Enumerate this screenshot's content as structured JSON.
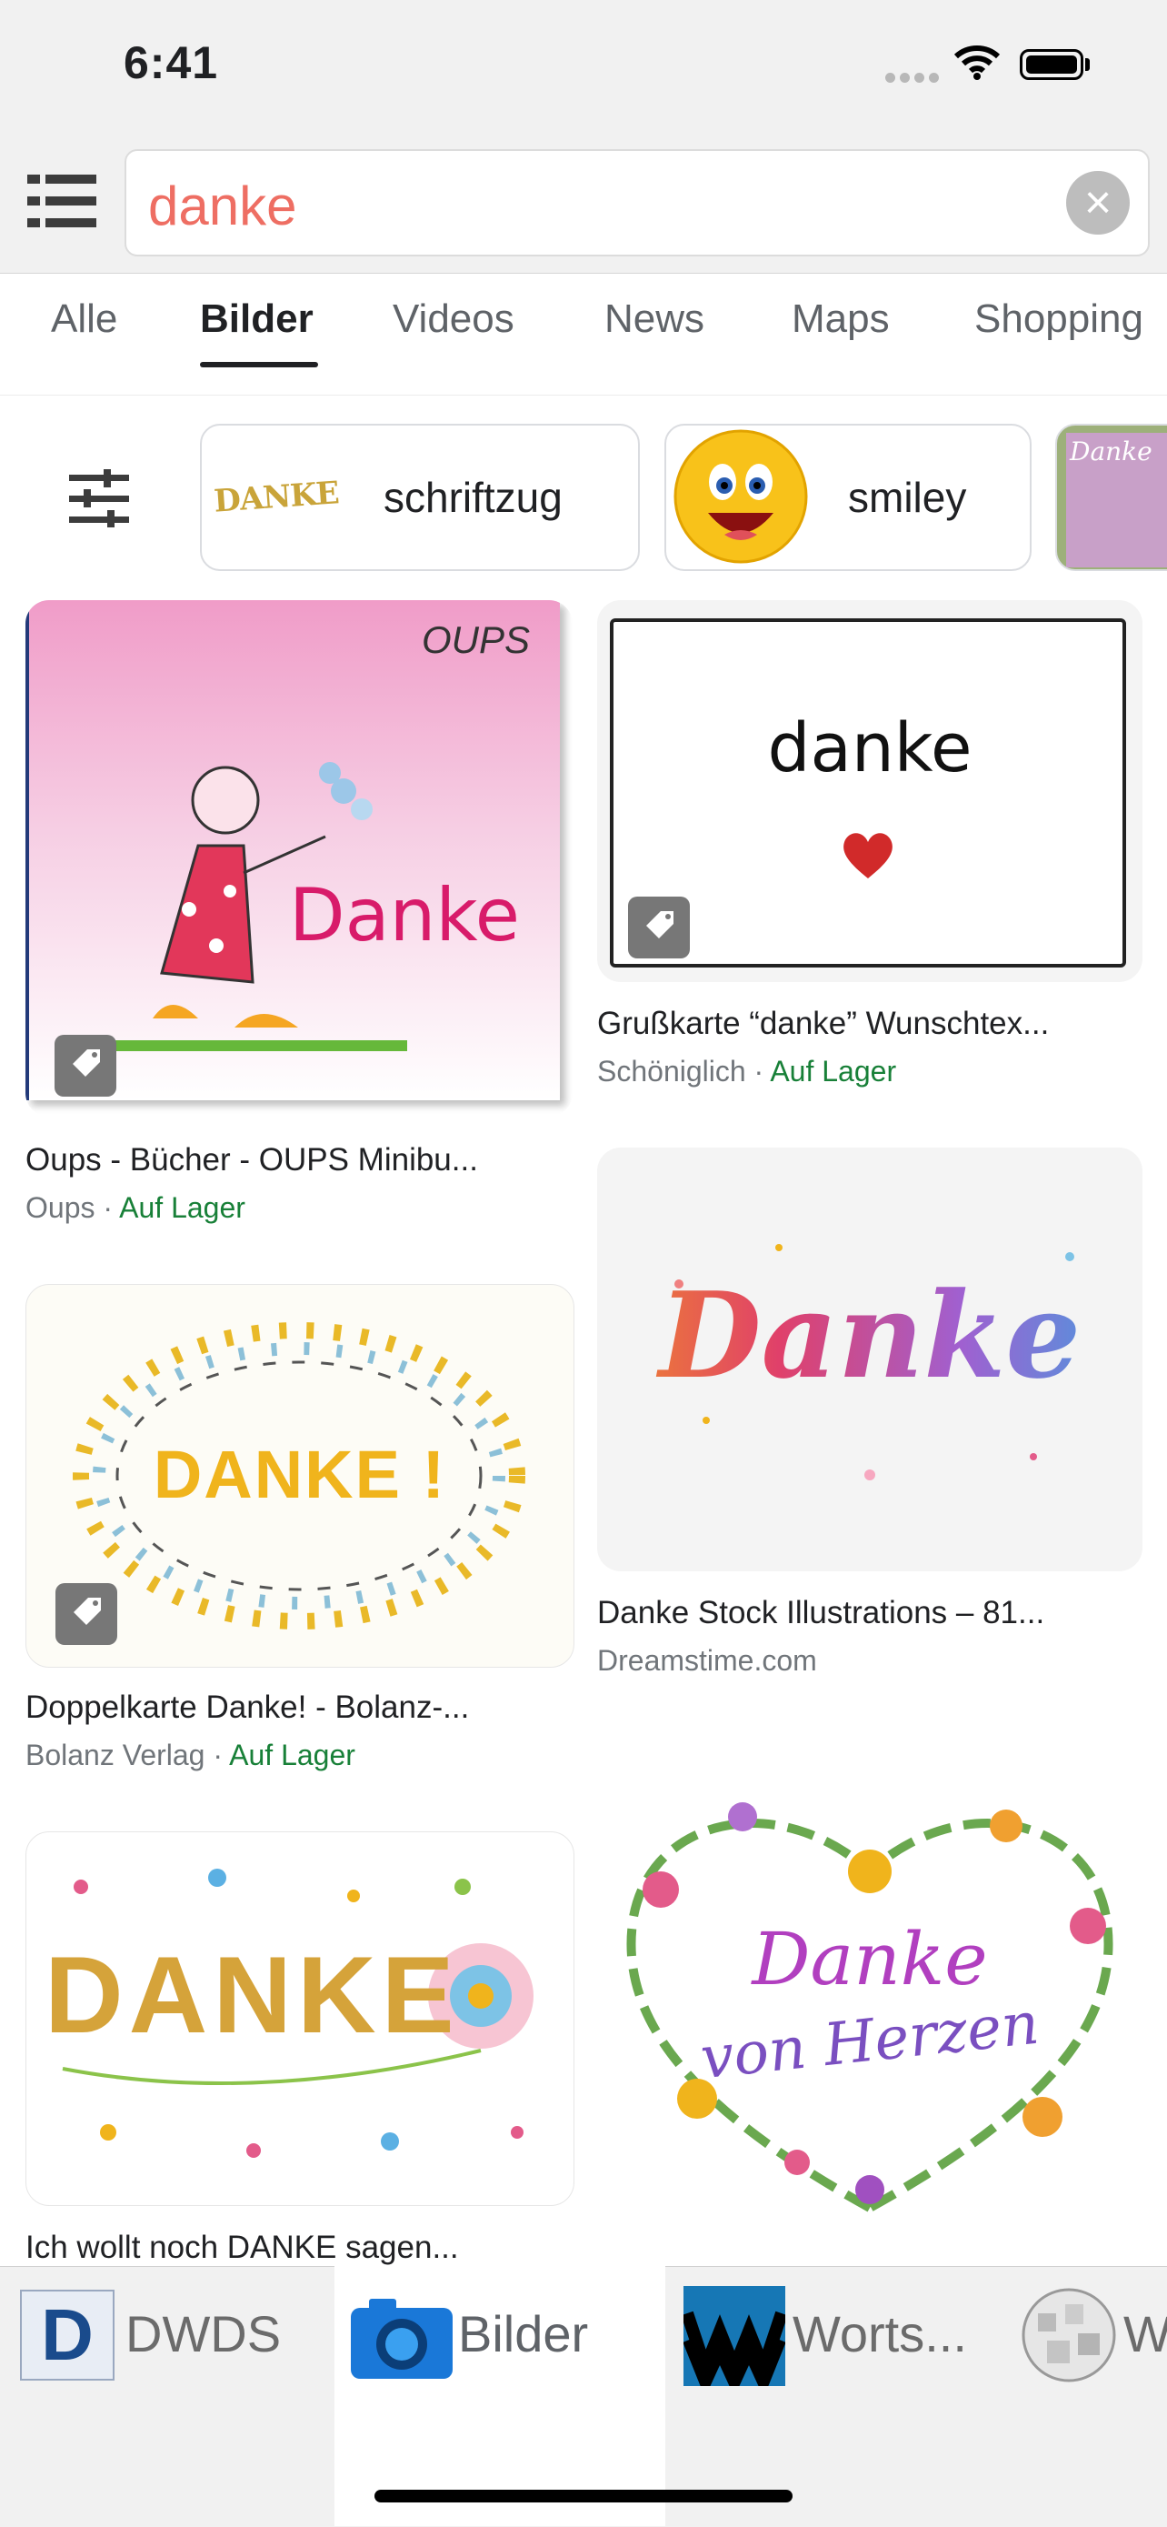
{
  "status_bar": {
    "time": "6:41"
  },
  "search": {
    "query": "danke"
  },
  "tabs": [
    {
      "label": "Alle"
    },
    {
      "label": "Bilder",
      "active": true
    },
    {
      "label": "Videos"
    },
    {
      "label": "News"
    },
    {
      "label": "Maps"
    },
    {
      "label": "Shopping"
    }
  ],
  "chips": [
    {
      "label": "schriftzug",
      "thumb_text": "DANKE"
    },
    {
      "label": "smiley"
    },
    {
      "label": "",
      "thumb_text": "Danke"
    }
  ],
  "results": {
    "left": [
      {
        "image_text": "Danke",
        "image_brand": "OUPS",
        "title": "Oups - Bücher - OUPS Minibu...",
        "source": "Oups",
        "stock": "Auf Lager"
      },
      {
        "image_text": "DANKE !",
        "title": "Doppelkarte Danke! - Bolanz-...",
        "source": "Bolanz Verlag",
        "stock": "Auf Lager"
      },
      {
        "image_text": "DANKE",
        "title": "Ich wollt noch DANKE sagen..."
      }
    ],
    "right": [
      {
        "image_text": "danke",
        "title": "Grußkarte “danke” Wunschtex...",
        "source": "Schöniglich",
        "stock": "Auf Lager"
      },
      {
        "image_text": "Danke",
        "title": "Danke Stock Illustrations – 81...",
        "source": "Dreamstime.com"
      },
      {
        "image_text_line1": "Danke",
        "image_text_line2": "von Herzen"
      }
    ]
  },
  "separator": " · ",
  "bottom_tabs": [
    {
      "label": "DWDS",
      "icon": "dwds-logo-icon"
    },
    {
      "label": "Bilder",
      "icon": "camera-icon",
      "active": true
    },
    {
      "label": "Worts...",
      "icon": "wortschatz-logo-icon"
    },
    {
      "label": "W",
      "icon": "wikipedia-globe-icon"
    }
  ],
  "colors": {
    "query": "#ee6e63",
    "in_stock": "#188038",
    "active_tab": "#202124"
  }
}
